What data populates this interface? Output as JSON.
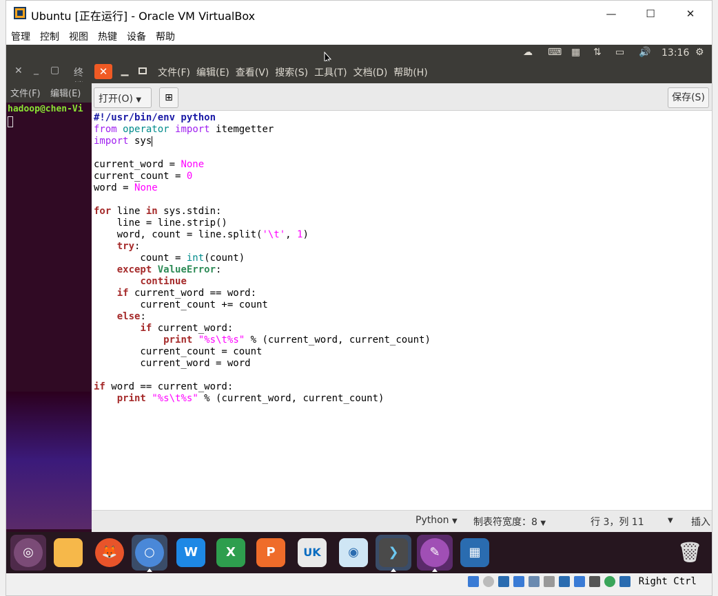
{
  "vbox": {
    "title": "Ubuntu [正在运行] - Oracle VM VirtualBox",
    "menus": [
      "管理",
      "控制",
      "视图",
      "热键",
      "设备",
      "帮助"
    ],
    "minimize": "—",
    "maximize": "☐",
    "close": "✕"
  },
  "panel": {
    "time": "13:16"
  },
  "terminal": {
    "title": "终端",
    "menus": [
      "文件(F)",
      "编辑(E)"
    ],
    "prompt": "hadoop@chen-Vi"
  },
  "gedit": {
    "menus": [
      "文件(F)",
      "编辑(E)",
      "查看(V)",
      "搜索(S)",
      "工具(T)",
      "文档(D)",
      "帮助(H)"
    ],
    "open_label": "打开(O)",
    "save_label": "保存(S)",
    "status": {
      "language": "Python",
      "tab_width": "制表符宽度：8",
      "position": "行 3，列 11",
      "mode": "插入"
    }
  },
  "launcher": {
    "items": [
      "dash",
      "files",
      "firefox",
      "chromium",
      "wps-writer",
      "wps-spreadsheets",
      "wps-presentation",
      "ubuntu-software-center",
      "hardware-info",
      "terminal",
      "text-editor",
      "workspace-switcher",
      "trash"
    ],
    "software_center_badge": "UK"
  },
  "vbox_status": {
    "host_key": "Right Ctrl"
  },
  "code_lines": [
    "#!/usr/bin/env python",
    "from operator import itemgetter",
    "import sys",
    "",
    "current_word = None",
    "current_count = 0",
    "word = None",
    "",
    "for line in sys.stdin:",
    "    line = line.strip()",
    "    word, count = line.split('\\t', 1)",
    "    try:",
    "        count = int(count)",
    "    except ValueError:",
    "        continue",
    "    if current_word == word:",
    "        current_count += count",
    "    else:",
    "        if current_word:",
    "            print \"%s\\t%s\" % (current_word, current_count)",
    "        current_count = count",
    "        current_word = word",
    "",
    "if word == current_word:",
    "    print \"%s\\t%s\" % (current_word, current_count)"
  ]
}
